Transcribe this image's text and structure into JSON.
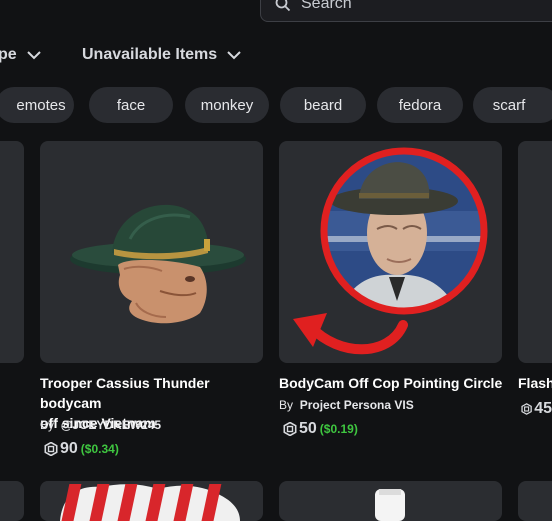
{
  "search": {
    "placeholder": "Search"
  },
  "filters": {
    "partial_label": "pe",
    "unavailable_label": "Unavailable Items"
  },
  "chips": [
    "emotes",
    "face",
    "monkey",
    "beard",
    "fedora",
    "scarf"
  ],
  "cards": [
    {
      "title_line1": "Trooper Cassius Thunder bodycam",
      "title_line2": "off since Vietnam",
      "by": "By",
      "creator": "@JOEYDREW245",
      "price": "90",
      "usd": "($0.34)"
    },
    {
      "title_line1": "BodyCam Off Cop Pointing Circle",
      "by": "By",
      "creator": "Project Persona VIS",
      "price": "50",
      "usd": "($0.19)"
    },
    {
      "title_partial": "Flash",
      "price_partial": "45"
    }
  ],
  "colors": {
    "background": "#111214",
    "card": "#2b2d31",
    "chip": "#2a2c31",
    "usd_green": "#3fc640",
    "circle_red": "#e02020"
  }
}
